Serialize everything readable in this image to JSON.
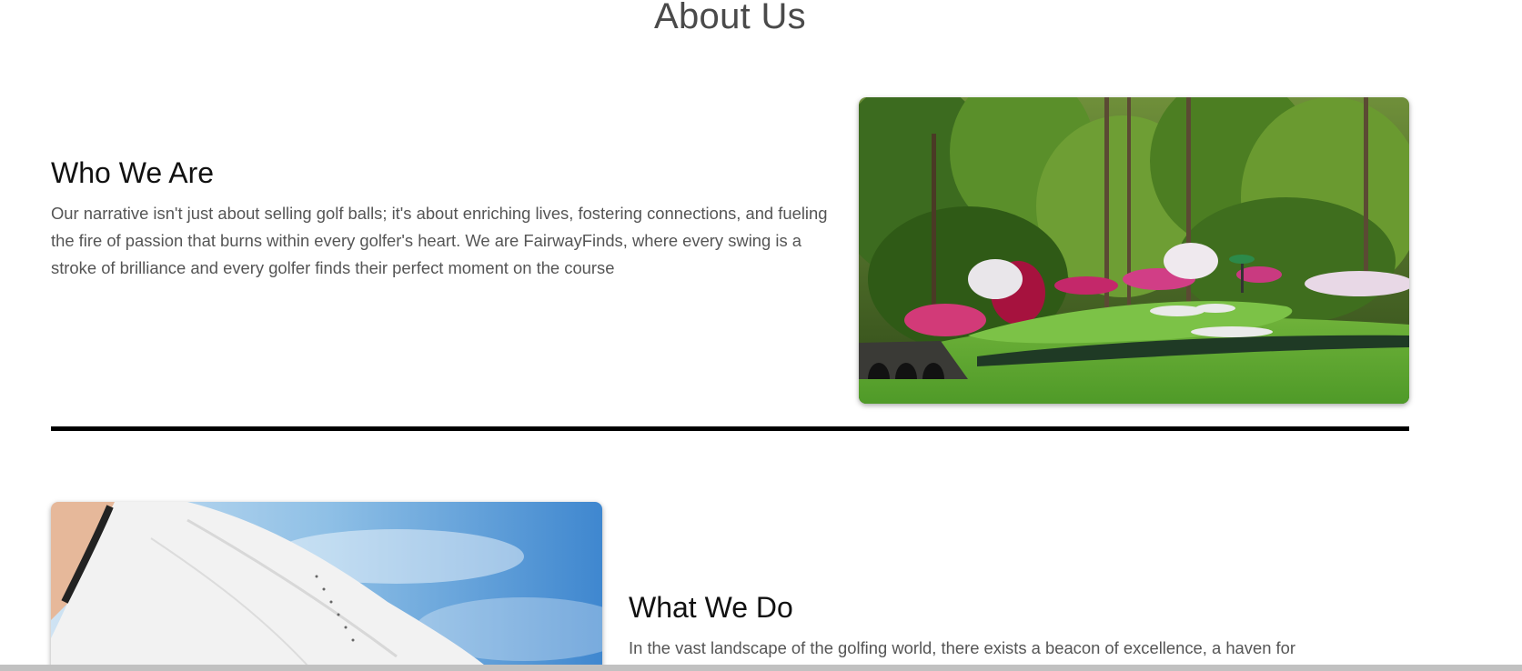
{
  "page": {
    "title": "About Us"
  },
  "who_we_are": {
    "heading": "Who We Are",
    "text": "Our narrative isn't just about selling golf balls; it's about enriching lives, fostering connections, and fueling the fire of passion that burns within every golfer's heart. We are FairwayFinds, where every swing is a stroke of brilliance and every golfer finds their perfect moment on the course"
  },
  "what_we_do": {
    "heading": "What We Do",
    "text": "In the vast landscape of the golfing world, there exists a beacon of excellence, a haven for"
  },
  "colors": {
    "title": "#4a4a4a",
    "heading": "#111111",
    "body_text": "#555555",
    "divider": "#000000"
  },
  "icons": {
    "course_image": "golf-course-photo",
    "glove_image": "golf-glove-photo"
  }
}
